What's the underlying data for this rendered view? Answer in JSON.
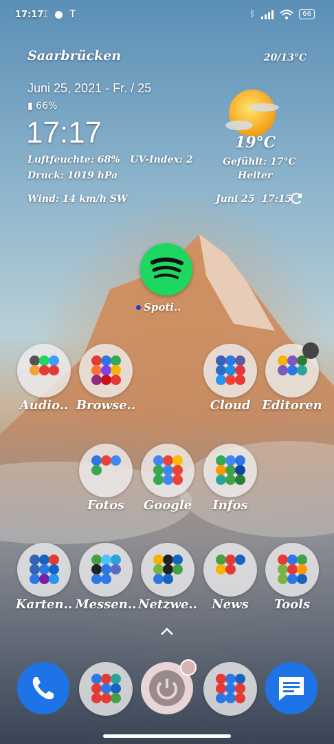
{
  "status_bar": {
    "time": "17:17",
    "battery": "66",
    "icons": [
      "text-cursor-icon",
      "dot-icon",
      "text-format-icon",
      "bluetooth-icon",
      "signal-icon",
      "wifi-icon",
      "battery-icon"
    ]
  },
  "weather": {
    "city": "Saarbrücken",
    "hi_lo": "20/13°C",
    "date": "Juni 25, 2021 - Fr. / 25",
    "battery": "66%",
    "clock": "17:17",
    "humidity_uv": "Luftfeuchte: 68%   UV-Index: 2",
    "pressure": "Druck: 1019 hPa",
    "wind": "Wind: 14 km/h SW",
    "current_temp": "19°C",
    "feels_like": "Gefühlt: 17°C",
    "condition": "Heiter",
    "updated": "Juni 25  17:15"
  },
  "spotify": {
    "label": "Spoti.."
  },
  "folders": [
    {
      "label": "Audio..",
      "colors": [
        "#555",
        "#1ed760",
        "#3aa0ff",
        "#f2a33a",
        "#e53935",
        "#e53935"
      ]
    },
    {
      "label": "Browse..",
      "colors": [
        "#e53935",
        "#2b78e4",
        "#34a853",
        "#ff7139",
        "#7a3ff0",
        "#f6b400",
        "#8e2b7d",
        "#cc0f1e",
        "#e53935"
      ]
    },
    {
      "label": "Cloud",
      "colors": [
        "#3563b5",
        "#2b78e4",
        "#5c5c9e",
        "#2b6cc4",
        "#1d8ee6",
        "#e0373f",
        "#2196f3",
        "#f44336",
        "#e53935"
      ]
    },
    {
      "label": "Editoren",
      "colors": [
        "#f6b400",
        "#7e57c2",
        "#2e7d32",
        "#7e57c2",
        "#2b78e4",
        "#26a69a"
      ]
    },
    {
      "label": "Fotos",
      "colors": [
        "#2b78e4",
        "#ea4335",
        "#4285f4",
        "#34a853"
      ]
    },
    {
      "label": "Google",
      "colors": [
        "#4285f4",
        "#ea4335",
        "#fbbc05",
        "#34a853",
        "#4285f4",
        "#ea4335",
        "#34a853",
        "#4285f4",
        "#ea4335"
      ]
    },
    {
      "label": "Infos",
      "colors": [
        "#34a853",
        "#4285f4",
        "#2b78e4",
        "#ff9800",
        "#43a047",
        "#0d47a1",
        "#26a69a",
        "#43a047",
        "#2e7d32"
      ]
    },
    {
      "label": "Karten..",
      "colors": [
        "#3563b5",
        "#1565c0",
        "#e53935",
        "#3563b5",
        "#2b78e4",
        "#1565c0",
        "#2b78e4",
        "#7b1fa2",
        "#2196f3"
      ]
    },
    {
      "label": "Messen..",
      "colors": [
        "#43a047",
        "#4fc3f7",
        "#2aa2df",
        "#222",
        "#2b78e4",
        "#5c6bc0",
        "#2b78e4",
        "#2b78e4"
      ]
    },
    {
      "label": "Netzwe..",
      "colors": [
        "#f6b400",
        "#222",
        "#1565c0",
        "#7cb342",
        "#222",
        "#43a047",
        "#2b78e4",
        "#1565c0"
      ]
    },
    {
      "label": "News",
      "colors": [
        "#43a047",
        "#e53935",
        "#1565c0",
        "#f6b400",
        "#e53935"
      ]
    },
    {
      "label": "Tools",
      "colors": [
        "#e53935",
        "#2b78e4",
        "#43a047",
        "#7cb342",
        "#e53935",
        "#ff9800",
        "#7cb342",
        "#2b78e4",
        "#1565c0"
      ]
    }
  ],
  "dock": {
    "phone": "phone-icon",
    "folder_left_colors": [
      "#2b78e4",
      "#e53935",
      "#26a69a",
      "#e53935",
      "#2b78e4",
      "#1565c0",
      "#e53935",
      "#e53935",
      "#43a047"
    ],
    "power": "power-icon",
    "folder_right_colors": [
      "#e53935",
      "#2b78e4",
      "#1565c0",
      "#e53935",
      "#2b78e4",
      "#e53935",
      "#2b78e4",
      "#2b78e4",
      "#e53935"
    ],
    "messages": "messages-icon"
  }
}
